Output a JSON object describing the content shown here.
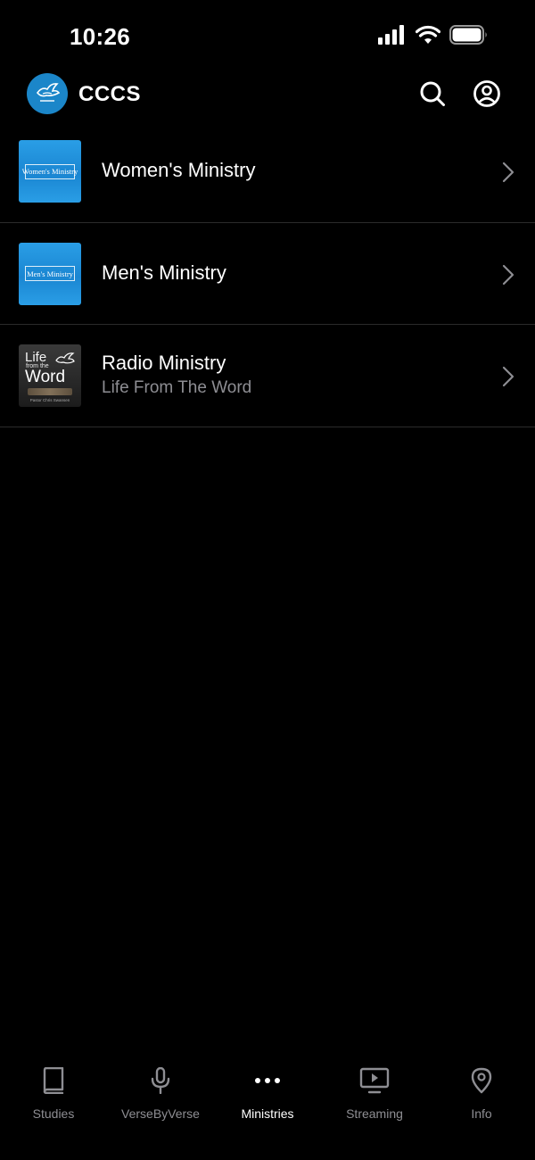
{
  "status_bar": {
    "time": "10:26"
  },
  "header": {
    "title": "CCCS",
    "logo_icon": "church-dove-logo",
    "search_icon": "search-icon",
    "account_icon": "account-icon"
  },
  "list": {
    "items": [
      {
        "title": "Women's Ministry",
        "subtitle": "",
        "thumb_text": "Women's Ministry"
      },
      {
        "title": "Men's Ministry",
        "subtitle": "",
        "thumb_text": "Men's Ministry"
      },
      {
        "title": "Radio Ministry",
        "subtitle": "Life From The Word",
        "thumb_life": "Life",
        "thumb_from": "from the",
        "thumb_word": "Word",
        "thumb_foot": "Pastor Chris Swansen"
      }
    ]
  },
  "tabs": [
    {
      "label": "Studies",
      "icon": "book-icon",
      "active": false
    },
    {
      "label": "VerseByVerse",
      "icon": "microphone-icon",
      "active": false
    },
    {
      "label": "Ministries",
      "icon": "more-dots-icon",
      "active": true
    },
    {
      "label": "Streaming",
      "icon": "tv-play-icon",
      "active": false
    },
    {
      "label": "Info",
      "icon": "location-pin-icon",
      "active": false
    }
  ],
  "colors": {
    "background": "#000000",
    "text_primary": "#ffffff",
    "text_secondary": "#8e8e93",
    "divider": "#2b2b2b",
    "brand_blue": "#1b86c9"
  }
}
